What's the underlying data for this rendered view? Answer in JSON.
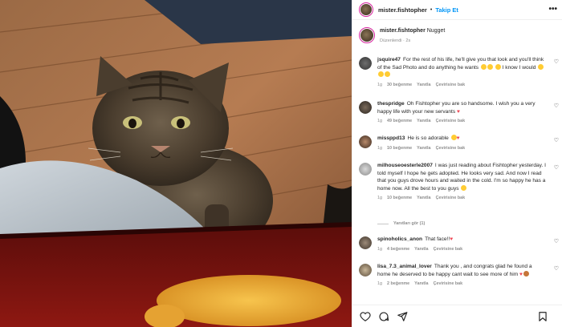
{
  "post": {
    "username": "mister.fishtopher",
    "follow_label": "Takip Et",
    "caption_user": "mister.fishtopher",
    "caption_text": "Nugget",
    "edited_label": "Düzenlendi · 2s"
  },
  "comments": [
    {
      "username": "jsquire47",
      "text": "For the rest of his life, he'll give you that look and you'll think of the Sad Photo and do anything he wants",
      "text2": "I know I would",
      "time": "1g",
      "likes": "30 beğenme",
      "reply": "Yanıtla",
      "translate": "Çevirisine bak"
    },
    {
      "username": "thespridge",
      "text": "Oh Fishtopher you are so handsome. I wish you a very happy life with your new servants",
      "time": "1g",
      "likes": "49 beğenme",
      "reply": "Yanıtla",
      "translate": "Çevirisine bak"
    },
    {
      "username": "missppd13",
      "text": "He is so adorable",
      "time": "1g",
      "likes": "10 beğenme",
      "reply": "Yanıtla",
      "translate": "Çevirisine bak"
    },
    {
      "username": "milhouseoesterle2007",
      "text": "I was just reading about Fishtopher yesterday. I told myself I hope he gets adopted. He looks very sad. And now I read that you guys drove hours and waited in the cold. I'm so happy he has a home now. All the best to you guys",
      "time": "1g",
      "likes": "10 beğenme",
      "reply": "Yanıtla",
      "translate": "Çevirisine bak"
    },
    {
      "username": "spinoholics_anon",
      "text": "That face!!",
      "time": "1g",
      "likes": "4 beğenme",
      "reply": "Yanıtla",
      "translate": "Çevirisine bak"
    },
    {
      "username": "lisa_7.3_animal_lover",
      "text": "Thank you , and congrats glad he found a home he deserved to be happy cant wait to see more of him",
      "time": "1g",
      "likes": "2 beğenme",
      "reply": "Yanıtla",
      "translate": "Çevirisine bak"
    }
  ],
  "view_replies_label": "Yanıtları gör (1)",
  "icons": {
    "more": "more-icon",
    "heart": "heart-icon",
    "comment": "comment-icon",
    "share": "share-icon",
    "save": "bookmark-icon"
  },
  "colors": {
    "link": "#0095f6",
    "muted": "#8e8e8e",
    "red_heart": "#ed4956"
  }
}
